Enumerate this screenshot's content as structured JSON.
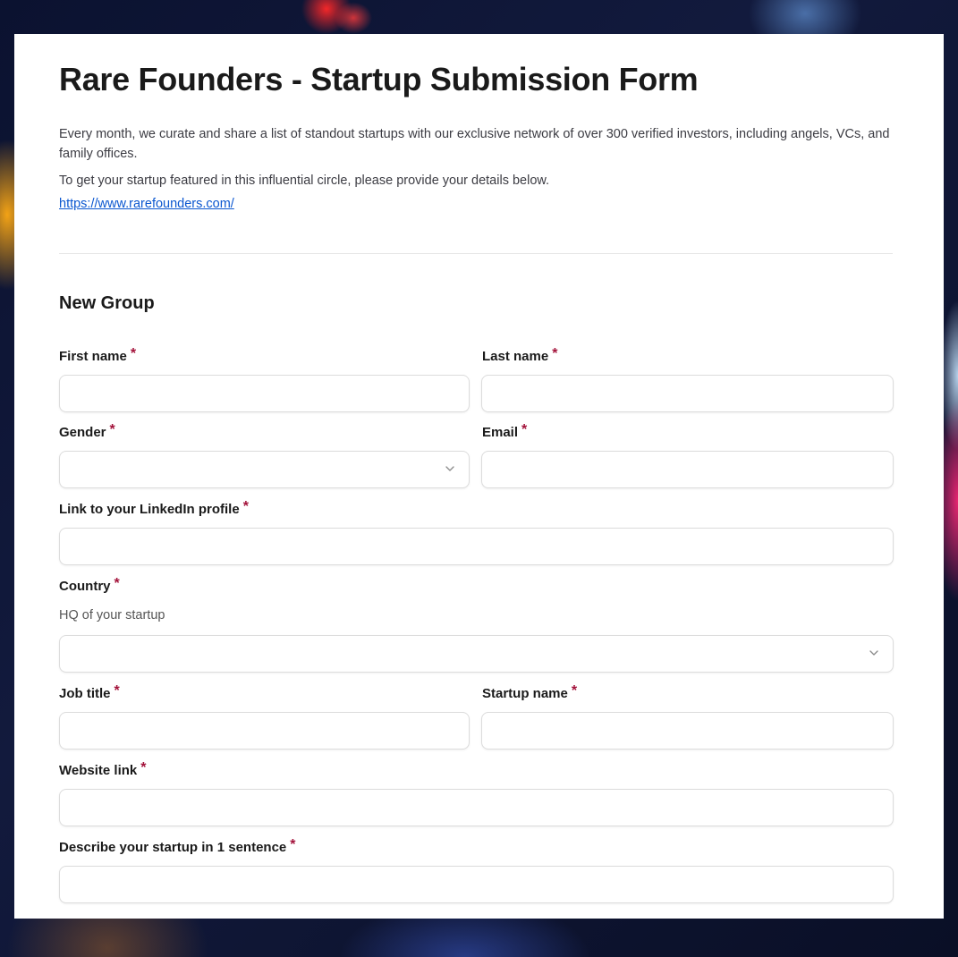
{
  "form": {
    "title": "Rare Founders - Startup Submission Form",
    "description_1": "Every month, we curate and share a list of standout startups with our exclusive network of over 300 verified investors, including angels, VCs, and family offices.",
    "description_2": "To get your startup featured in this influential circle, please provide your details below.",
    "link": "https://www.rarefounders.com/",
    "required_marker": "*"
  },
  "group": {
    "title": "New Group"
  },
  "fields": {
    "first_name": {
      "label": "First name",
      "value": ""
    },
    "last_name": {
      "label": "Last name",
      "value": ""
    },
    "gender": {
      "label": "Gender",
      "value": ""
    },
    "email": {
      "label": "Email",
      "value": ""
    },
    "linkedin": {
      "label": "Link to your LinkedIn profile",
      "value": ""
    },
    "country": {
      "label": "Country",
      "helper": "HQ of your startup",
      "value": ""
    },
    "job_title": {
      "label": "Job title",
      "value": ""
    },
    "startup_name": {
      "label": "Startup name",
      "value": ""
    },
    "website": {
      "label": "Website link",
      "value": ""
    },
    "describe": {
      "label": "Describe your startup in 1 sentence",
      "value": ""
    }
  },
  "icons": {
    "select_arrow": "chevron-down-icon"
  },
  "colors": {
    "required": "#a3123a",
    "link": "#0b57d0"
  }
}
